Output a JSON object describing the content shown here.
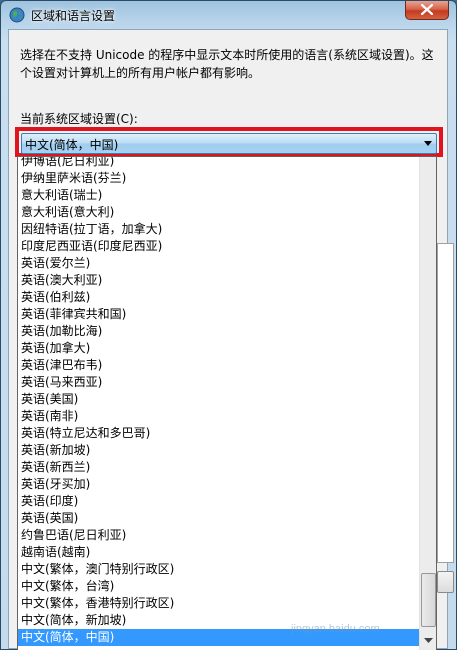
{
  "window": {
    "title": "区域和语言设置"
  },
  "content": {
    "description": "选择在不支持 Unicode 的程序中显示文本时所使用的语言(系统区域设置)。这个设置对计算机上的所有用户帐户都有影响。",
    "current_label": "当前系统区域设置(C):",
    "current_value": "中文(简体，中国)"
  },
  "dropdown": {
    "items": [
      "伊博语(尼日利亚)",
      "伊纳里萨米语(芬兰)",
      "意大利语(瑞士)",
      "意大利语(意大利)",
      "因纽特语(拉丁语，加拿大)",
      "印度尼西亚语(印度尼西亚)",
      "英语(爱尔兰)",
      "英语(澳大利亚)",
      "英语(伯利兹)",
      "英语(菲律宾共和国)",
      "英语(加勒比海)",
      "英语(加拿大)",
      "英语(津巴布韦)",
      "英语(马来西亚)",
      "英语(美国)",
      "英语(南非)",
      "英语(特立尼达和多巴哥)",
      "英语(新加坡)",
      "英语(新西兰)",
      "英语(牙买加)",
      "英语(印度)",
      "英语(英国)",
      "约鲁巴语(尼日利亚)",
      "越南语(越南)",
      "中文(繁体，澳门特别行政区)",
      "中文(繁体，台湾)",
      "中文(繁体，香港特别行政区)",
      "中文(简体，新加坡)",
      "中文(简体，中国)"
    ],
    "selected_index": 28
  },
  "watermark": "jingyan.baidu.com",
  "colors": {
    "highlight_border": "#e0141e",
    "selection": "#3399ff"
  }
}
